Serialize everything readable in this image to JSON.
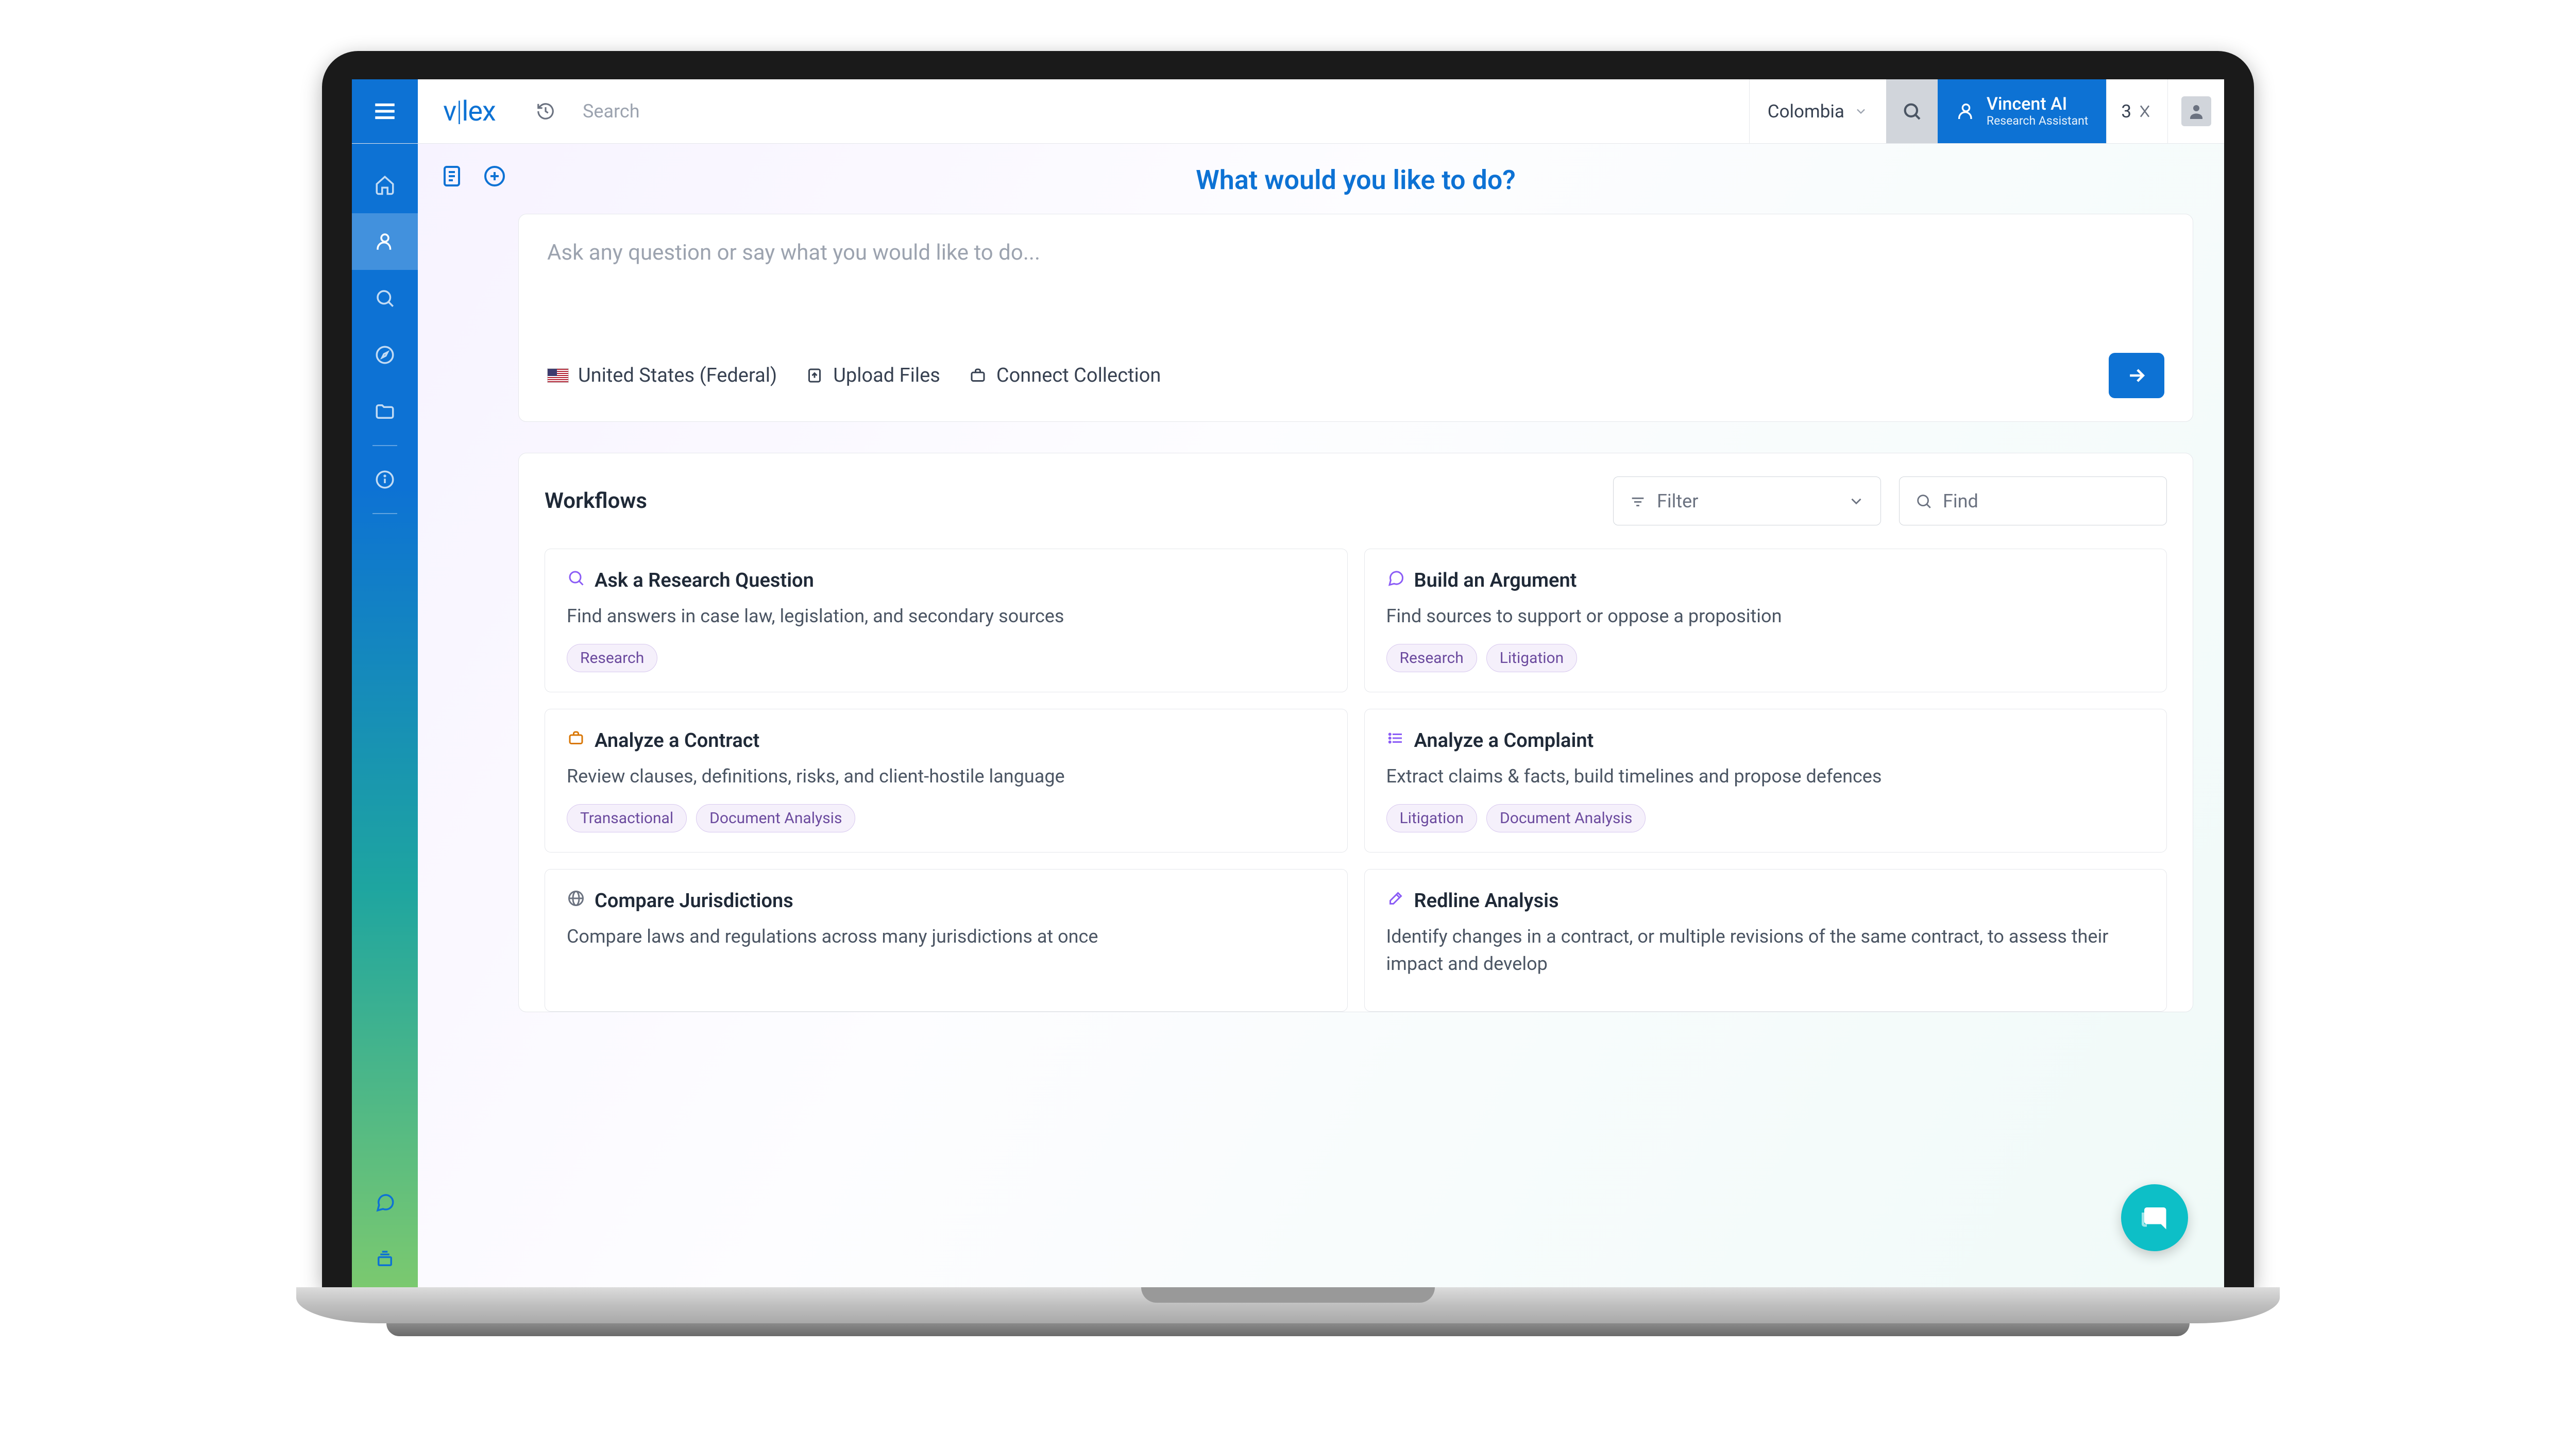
{
  "topbar": {
    "search_placeholder": "Search",
    "country": "Colombia",
    "vincent_title": "Vincent AI",
    "vincent_sub": "Research Assistant",
    "credits": "3"
  },
  "leftcol": {},
  "main": {
    "heading": "What would you like to do?",
    "prompt_placeholder": "Ask any question or say what you would like to do...",
    "jurisdiction": "United States (Federal)",
    "upload_label": "Upload Files",
    "connect_label": "Connect Collection"
  },
  "workflows": {
    "title": "Workflows",
    "filter_label": "Filter",
    "find_label": "Find",
    "items": [
      {
        "title": "Ask a Research Question",
        "desc": "Find answers in case law, legislation, and secondary sources",
        "tags": [
          "Research"
        ],
        "icon": "search",
        "icon_color": "#8b5cf6"
      },
      {
        "title": "Build an Argument",
        "desc": "Find sources to support or oppose a proposition",
        "tags": [
          "Research",
          "Litigation"
        ],
        "icon": "message",
        "icon_color": "#8b5cf6"
      },
      {
        "title": "Analyze a Contract",
        "desc": "Review clauses, definitions, risks, and client-hostile language",
        "tags": [
          "Transactional",
          "Document Analysis"
        ],
        "icon": "briefcase",
        "icon_color": "#d97706"
      },
      {
        "title": "Analyze a Complaint",
        "desc": "Extract claims & facts, build timelines and propose defences",
        "tags": [
          "Litigation",
          "Document Analysis"
        ],
        "icon": "list",
        "icon_color": "#8b5cf6"
      },
      {
        "title": "Compare Jurisdictions",
        "desc": "Compare laws and regulations across many jurisdictions at once",
        "tags": [],
        "icon": "globe",
        "icon_color": "#6b7280"
      },
      {
        "title": "Redline Analysis",
        "desc": "Identify changes in a contract, or multiple revisions of the same contract, to assess their impact and develop",
        "tags": [],
        "icon": "edit",
        "icon_color": "#8b5cf6"
      }
    ]
  }
}
